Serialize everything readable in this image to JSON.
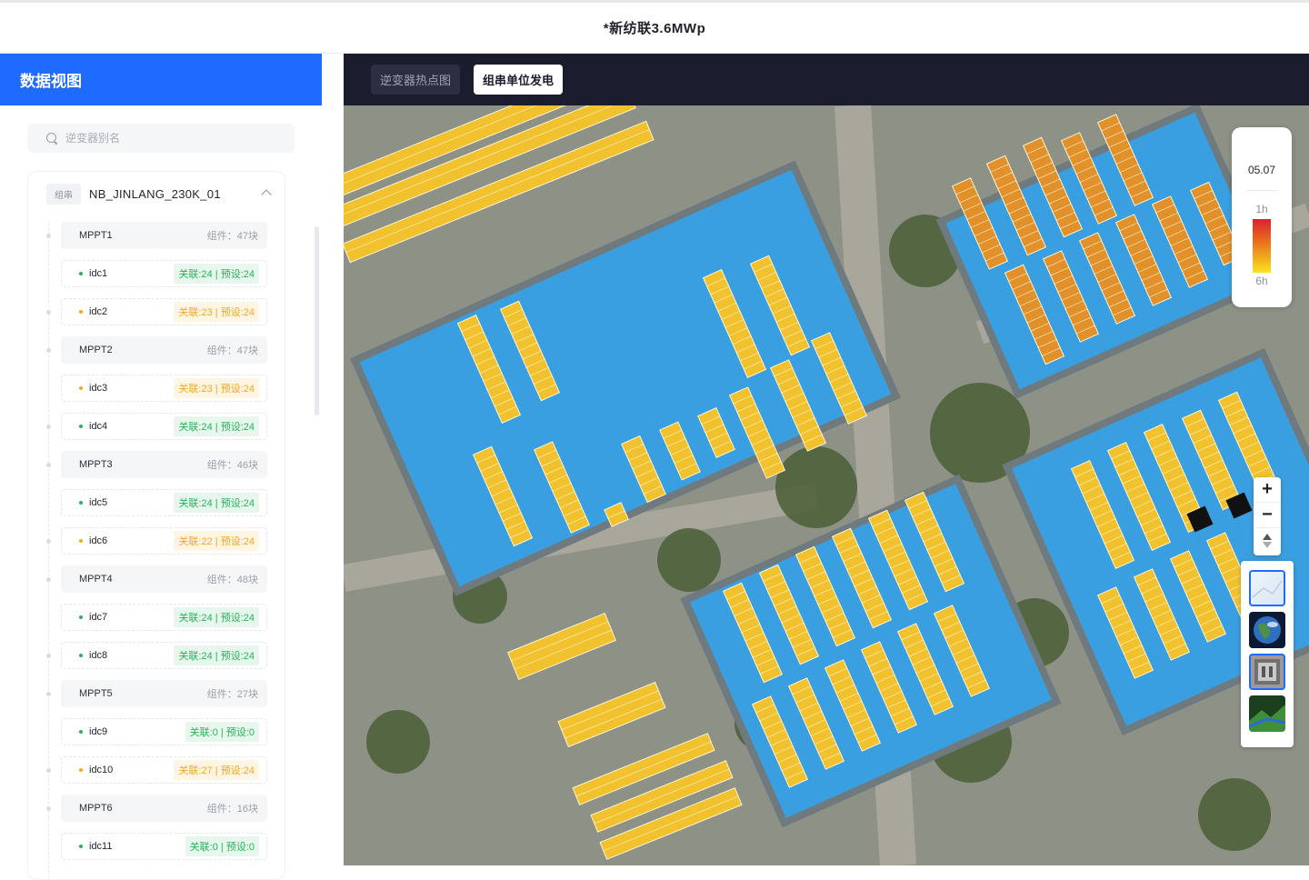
{
  "app": {
    "title": "*新纺联3.6MWp"
  },
  "sidebar": {
    "title": "数据视图",
    "search": {
      "placeholder": "逆变器别名",
      "value": ""
    },
    "group": {
      "tag": "组串",
      "name": "NB_JINLANG_230K_01"
    },
    "mppts": [
      {
        "label": "MPPT1",
        "count": "组件：47块"
      },
      {
        "label": "MPPT2",
        "count": "组件：47块"
      },
      {
        "label": "MPPT3",
        "count": "组件：46块"
      },
      {
        "label": "MPPT4",
        "count": "组件：48块"
      },
      {
        "label": "MPPT5",
        "count": "组件：27块"
      },
      {
        "label": "MPPT6",
        "count": "组件：16块"
      }
    ],
    "idcs": [
      {
        "label": "idc1",
        "badge": "关联:24 | 预设:24",
        "status": "ok"
      },
      {
        "label": "idc2",
        "badge": "关联:23 | 预设:24",
        "status": "warn"
      },
      {
        "label": "idc3",
        "badge": "关联:23 | 预设:24",
        "status": "warn"
      },
      {
        "label": "idc4",
        "badge": "关联:24 | 预设:24",
        "status": "ok"
      },
      {
        "label": "idc5",
        "badge": "关联:24 | 预设:24",
        "status": "ok"
      },
      {
        "label": "idc6",
        "badge": "关联:22 | 预设:24",
        "status": "warn"
      },
      {
        "label": "idc7",
        "badge": "关联:24 | 预设:24",
        "status": "ok"
      },
      {
        "label": "idc8",
        "badge": "关联:24 | 预设:24",
        "status": "ok"
      },
      {
        "label": "idc9",
        "badge": "关联:0 | 预设:0",
        "status": "ok"
      },
      {
        "label": "idc10",
        "badge": "关联:27 | 预设:24",
        "status": "warn"
      },
      {
        "label": "idc11",
        "badge": "关联:0 | 预设:0",
        "status": "ok"
      }
    ]
  },
  "map": {
    "tabs": [
      {
        "label": "逆变器热点图",
        "active": false
      },
      {
        "label": "组串单位发电",
        "active": true
      }
    ],
    "legend": {
      "date": "05.07",
      "top_label": "1h",
      "bottom_label": "6h"
    },
    "zoom": {
      "in": "+",
      "out": "−",
      "compass": "▲▼"
    },
    "layers": [
      "map-layer-icon",
      "globe-icon",
      "building-icon",
      "terrain-icon"
    ],
    "colors": {
      "roof": "#3a9fe0",
      "panel_yellow": "#f2c12e",
      "panel_orange": "#e2902a",
      "accent": "#1f6bff"
    }
  }
}
